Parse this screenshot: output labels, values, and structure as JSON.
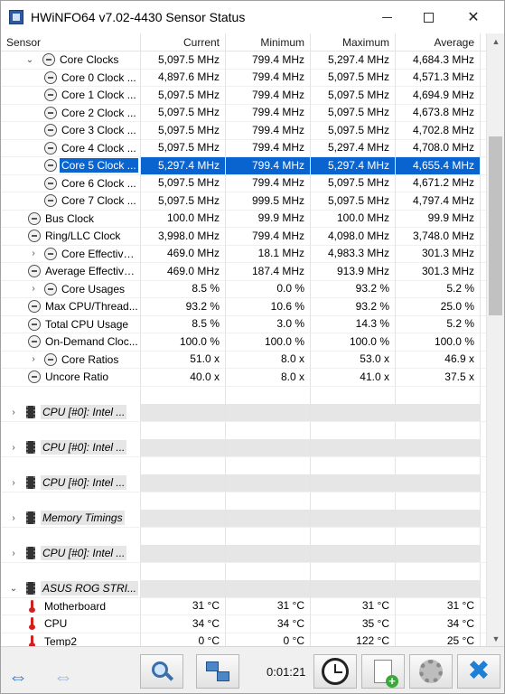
{
  "window": {
    "title": "HWiNFO64 v7.02-4430 Sensor Status",
    "controls": {
      "minimize": "—",
      "maximize": "☐",
      "close": "✕"
    }
  },
  "header": {
    "sensor": "Sensor",
    "current": "Current",
    "minimum": "Minimum",
    "maximum": "Maximum",
    "average": "Average"
  },
  "rows": {
    "core_clocks": {
      "label": "Core Clocks",
      "current": "5,097.5 MHz",
      "minimum": "799.4 MHz",
      "maximum": "5,297.4 MHz",
      "average": "4,684.3 MHz"
    },
    "core0": {
      "label": "Core 0 Clock ...",
      "current": "4,897.6 MHz",
      "minimum": "799.4 MHz",
      "maximum": "5,097.5 MHz",
      "average": "4,571.3 MHz"
    },
    "core1": {
      "label": "Core 1 Clock ...",
      "current": "5,097.5 MHz",
      "minimum": "799.4 MHz",
      "maximum": "5,097.5 MHz",
      "average": "4,694.9 MHz"
    },
    "core2": {
      "label": "Core 2 Clock ...",
      "current": "5,097.5 MHz",
      "minimum": "799.4 MHz",
      "maximum": "5,097.5 MHz",
      "average": "4,673.8 MHz"
    },
    "core3": {
      "label": "Core 3 Clock ...",
      "current": "5,097.5 MHz",
      "minimum": "799.4 MHz",
      "maximum": "5,097.5 MHz",
      "average": "4,702.8 MHz"
    },
    "core4": {
      "label": "Core 4 Clock ...",
      "current": "5,097.5 MHz",
      "minimum": "799.4 MHz",
      "maximum": "5,297.4 MHz",
      "average": "4,708.0 MHz"
    },
    "core5": {
      "label": "Core 5 Clock ...",
      "current": "5,297.4 MHz",
      "minimum": "799.4 MHz",
      "maximum": "5,297.4 MHz",
      "average": "4,655.4 MHz"
    },
    "core6": {
      "label": "Core 6 Clock ...",
      "current": "5,097.5 MHz",
      "minimum": "799.4 MHz",
      "maximum": "5,097.5 MHz",
      "average": "4,671.2 MHz"
    },
    "core7": {
      "label": "Core 7 Clock ...",
      "current": "5,097.5 MHz",
      "minimum": "999.5 MHz",
      "maximum": "5,097.5 MHz",
      "average": "4,797.4 MHz"
    },
    "bus_clock": {
      "label": "Bus Clock",
      "current": "100.0 MHz",
      "minimum": "99.9 MHz",
      "maximum": "100.0 MHz",
      "average": "99.9 MHz"
    },
    "ring_clock": {
      "label": "Ring/LLC Clock",
      "current": "3,998.0 MHz",
      "minimum": "799.4 MHz",
      "maximum": "4,098.0 MHz",
      "average": "3,748.0 MHz"
    },
    "core_effective": {
      "label": "Core Effective...",
      "current": "469.0 MHz",
      "minimum": "18.1 MHz",
      "maximum": "4,983.3 MHz",
      "average": "301.3 MHz"
    },
    "avg_effective": {
      "label": "Average Effective...",
      "current": "469.0 MHz",
      "minimum": "187.4 MHz",
      "maximum": "913.9 MHz",
      "average": "301.3 MHz"
    },
    "core_usages": {
      "label": "Core Usages",
      "current": "8.5 %",
      "minimum": "0.0 %",
      "maximum": "93.2 %",
      "average": "5.2 %"
    },
    "max_cpu_thread": {
      "label": "Max CPU/Thread...",
      "current": "93.2 %",
      "minimum": "10.6 %",
      "maximum": "93.2 %",
      "average": "25.0 %"
    },
    "total_cpu": {
      "label": "Total CPU Usage",
      "current": "8.5 %",
      "minimum": "3.0 %",
      "maximum": "14.3 %",
      "average": "5.2 %"
    },
    "on_demand": {
      "label": "On-Demand Cloc...",
      "current": "100.0 %",
      "minimum": "100.0 %",
      "maximum": "100.0 %",
      "average": "100.0 %"
    },
    "core_ratios": {
      "label": "Core Ratios",
      "current": "51.0 x",
      "minimum": "8.0 x",
      "maximum": "53.0 x",
      "average": "46.9 x"
    },
    "uncore_ratio": {
      "label": "Uncore Ratio",
      "current": "40.0 x",
      "minimum": "8.0 x",
      "maximum": "41.0 x",
      "average": "37.5 x"
    },
    "group1": {
      "label": "CPU [#0]: Intel ..."
    },
    "group2": {
      "label": "CPU [#0]: Intel ..."
    },
    "group3": {
      "label": "CPU [#0]: Intel ..."
    },
    "group4": {
      "label": "Memory Timings"
    },
    "group5": {
      "label": "CPU [#0]: Intel ..."
    },
    "group6": {
      "label": "ASUS ROG STRI..."
    },
    "motherboard": {
      "label": "Motherboard",
      "current": "31 °C",
      "minimum": "31 °C",
      "maximum": "31 °C",
      "average": "31 °C"
    },
    "cpu_temp": {
      "label": "CPU",
      "current": "34 °C",
      "minimum": "34 °C",
      "maximum": "35 °C",
      "average": "34 °C"
    },
    "temp2": {
      "label": "Temp2",
      "current": "0 °C",
      "minimum": "0 °C",
      "maximum": "122 °C",
      "average": "25 °C"
    }
  },
  "toolbar": {
    "timer": "0:01:21",
    "nav_left": "⇔",
    "nav_right": "⇔",
    "close_symbol": "✖"
  },
  "colors": {
    "selection": "#0a64d0",
    "group_bg": "#e6e6e6",
    "accent": "#1e7fd6"
  }
}
